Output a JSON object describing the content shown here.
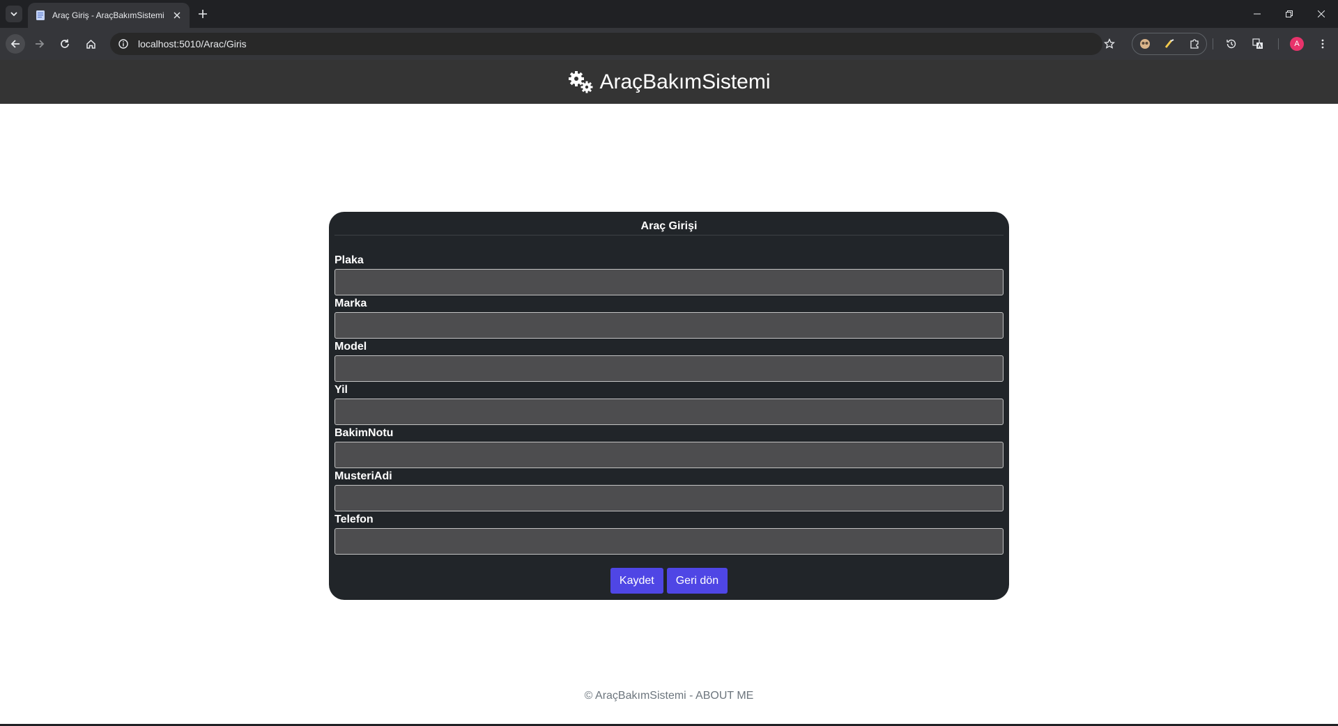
{
  "browser": {
    "tab_title": "Araç Giriş - AraçBakımSistemi",
    "url": "localhost:5010/Arac/Giris",
    "profile_initial": "A"
  },
  "site": {
    "brand": "AraçBakımSistemi"
  },
  "form": {
    "title": "Araç Girişi",
    "fields": [
      {
        "label": "Plaka",
        "value": ""
      },
      {
        "label": "Marka",
        "value": ""
      },
      {
        "label": "Model",
        "value": ""
      },
      {
        "label": "Yil",
        "value": ""
      },
      {
        "label": "BakimNotu",
        "value": ""
      },
      {
        "label": "MusteriAdi",
        "value": ""
      },
      {
        "label": "Telefon",
        "value": ""
      }
    ],
    "save_label": "Kaydet",
    "back_label": "Geri dön"
  },
  "footer": {
    "text": "© AraçBakımSistemi - ABOUT ME"
  },
  "colors": {
    "header_bg": "#343434",
    "card_bg": "#212529",
    "input_bg": "#4d4d4f",
    "button": "#4f46e5"
  }
}
